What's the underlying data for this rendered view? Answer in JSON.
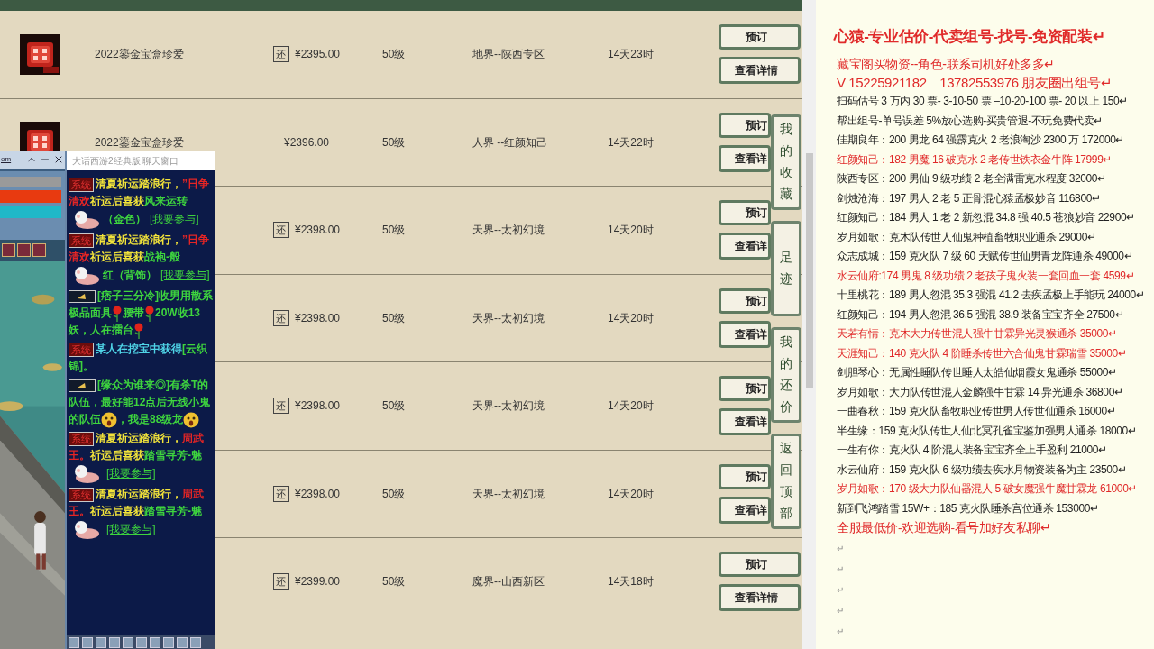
{
  "listing": {
    "rows": [
      {
        "item_icon": true,
        "name": "2022鎏金宝盒珍爱",
        "tag": "还",
        "price": "¥2395.00",
        "level": "50级",
        "server": "地界--陕西专区",
        "time": "14天23时",
        "reserve": "预订",
        "detail": "查看详情"
      },
      {
        "item_icon": true,
        "name": "2022鎏金宝盒珍爱",
        "price": "¥2396.00",
        "level": "50级",
        "server": "人界 --红颜知己",
        "time": "14天22时",
        "reserve": "预订",
        "detail": "查看详"
      },
      {
        "item_icon": false,
        "tag": "还",
        "price": "¥2398.00",
        "level": "50级",
        "server": "天界--太初幻境",
        "time": "14天20时",
        "reserve": "预订",
        "detail": "查看详"
      },
      {
        "item_icon": false,
        "tag": "还",
        "price": "¥2398.00",
        "level": "50级",
        "server": "天界--太初幻境",
        "time": "14天20时",
        "reserve": "预订",
        "detail": "查看详"
      },
      {
        "item_icon": false,
        "tag": "还",
        "price": "¥2398.00",
        "level": "50级",
        "server": "天界--太初幻境",
        "time": "14天20时",
        "reserve": "预订",
        "detail": "查看详"
      },
      {
        "item_icon": false,
        "tag": "还",
        "price": "¥2398.00",
        "level": "50级",
        "server": "天界--太初幻境",
        "time": "14天20时",
        "reserve": "预订",
        "detail": "查看详"
      },
      {
        "item_icon": false,
        "tag": "还",
        "price": "¥2399.00",
        "level": "50级",
        "server": "魔界--山西新区",
        "time": "14天18时",
        "reserve": "预订",
        "detail": "查看详情"
      }
    ]
  },
  "side_nav": [
    "我的收藏",
    "足迹",
    "我的还价",
    "返回顶部"
  ],
  "game_window": {
    "title_fragment": "om"
  },
  "chat_window": {
    "title": "大话西游2经典版 聊天窗口",
    "messages": [
      {
        "kind": "system",
        "badge": "系统",
        "segments": [
          {
            "kind": "text",
            "text": "清夏祈运踏浪行，",
            "color": "#f2e33a"
          },
          {
            "kind": "text",
            "text": "”日争清欢",
            "color": "#e42525"
          },
          {
            "kind": "text",
            "text": "祈运后喜获",
            "color": "#f2e33a"
          },
          {
            "kind": "text",
            "text": "风来运转",
            "color": "#3ed43e"
          },
          {
            "kind": "pig"
          },
          {
            "kind": "text",
            "text": "（金色）",
            "color": "#3ed43e"
          },
          {
            "kind": "link",
            "text": "[我要参与]"
          }
        ]
      },
      {
        "kind": "system",
        "badge": "系统",
        "segments": [
          {
            "kind": "text",
            "text": "清夏祈运踏浪行，",
            "color": "#f2e33a"
          },
          {
            "kind": "text",
            "text": "”日争清欢",
            "color": "#e42525"
          },
          {
            "kind": "text",
            "text": "祈运后喜获",
            "color": "#f2e33a"
          },
          {
            "kind": "text",
            "text": "战袍-般",
            "color": "#3ed43e"
          },
          {
            "kind": "pig"
          },
          {
            "kind": "text",
            "text": "红（背饰）",
            "color": "#3ed43e"
          },
          {
            "kind": "link",
            "text": "[我要参与]"
          }
        ]
      },
      {
        "kind": "player",
        "segments": [
          {
            "kind": "text",
            "text": "[痞子三分冷]收男用散系极品面具",
            "color": "#3ed43e"
          },
          {
            "kind": "flower"
          },
          {
            "kind": "text",
            "text": "腰带",
            "color": "#3ed43e"
          },
          {
            "kind": "flower"
          },
          {
            "kind": "text",
            "text": "20W收13妖，人在擂台",
            "color": "#3ed43e"
          },
          {
            "kind": "flower"
          }
        ]
      },
      {
        "kind": "system",
        "badge": "系统",
        "segments": [
          {
            "kind": "text",
            "text": "某人在挖宝中获得",
            "color": "#4fd3e6"
          },
          {
            "kind": "text",
            "text": "[云织锦]。",
            "color": "#3ed43e"
          }
        ]
      },
      {
        "kind": "player",
        "segments": [
          {
            "kind": "text",
            "text": "[缘众为谁来◎]有杀T的队伍，最好能12点后无线小鬼的队伍",
            "color": "#3ed43e"
          },
          {
            "kind": "face"
          },
          {
            "kind": "text",
            "text": "，我是88级龙",
            "color": "#3ed43e"
          },
          {
            "kind": "face"
          }
        ]
      },
      {
        "kind": "system",
        "badge": "系统",
        "segments": [
          {
            "kind": "text",
            "text": "清夏祈运踏浪行，",
            "color": "#f2e33a"
          },
          {
            "kind": "text",
            "text": "周武王。",
            "color": "#e42525"
          },
          {
            "kind": "text",
            "text": "祈运后喜获",
            "color": "#f2e33a"
          },
          {
            "kind": "text",
            "text": "踏雪寻芳-魅",
            "color": "#3ed43e"
          },
          {
            "kind": "pig"
          },
          {
            "kind": "link",
            "text": "[我要参与]"
          }
        ]
      },
      {
        "kind": "system",
        "badge": "系统",
        "segments": [
          {
            "kind": "text",
            "text": "清夏祈运踏浪行，",
            "color": "#f2e33a"
          },
          {
            "kind": "text",
            "text": "周武王。",
            "color": "#e42525"
          },
          {
            "kind": "text",
            "text": "祈运后喜获",
            "color": "#f2e33a"
          },
          {
            "kind": "text",
            "text": "踏雪寻芳-魅",
            "color": "#3ed43e"
          },
          {
            "kind": "pig"
          },
          {
            "kind": "link",
            "text": "[我要参与]"
          }
        ]
      }
    ]
  },
  "document": {
    "lines": [
      {
        "kind": "title",
        "text": "心猿-专业估价-代卖组号-找号-免资配装↵",
        "color": "#e02a2a"
      },
      {
        "kind": "subtitle",
        "text": "藏宝阁买物资--角色-联系司机好处多多↵",
        "color": "#e02a2a"
      },
      {
        "kind": "phone",
        "text": "V 15225921182　13782553976 朋友圈出组号↵",
        "color": "#e02a2a"
      },
      {
        "kind": "body",
        "text": "扫码估号 3 万内 30 票- 3-10-50 票 –10-20-100 票- 20 以上 150↵",
        "color": "#222222"
      },
      {
        "kind": "body",
        "text": "帮出组号-单号误差 5%放心选购-买贵管退-不玩免费代卖↵",
        "color": "#222222"
      },
      {
        "kind": "body",
        "text": "佳期良年：200 男龙 64 强霹克火 2 老浪淘沙 2300 万 172000↵",
        "color": "#222222"
      },
      {
        "kind": "body",
        "text": "红颜知己：182 男魔 16 破克水 2 老传世铁衣金牛阵 17999↵",
        "color": "#e02a2a"
      },
      {
        "kind": "body",
        "text": "陕西专区：200 男仙 9 级功绩 2 老全满雷克水程度 32000↵",
        "color": "#222222"
      },
      {
        "kind": "body",
        "text": "剑烛沧海：197 男人 2 老 5 正骨混心猿孟极妙音 116800↵",
        "color": "#222222"
      },
      {
        "kind": "body",
        "text": "红颜知己：184 男人 1 老 2 新忽混 34.8 强 40.5 苍狼妙音 22900↵",
        "color": "#222222"
      },
      {
        "kind": "body",
        "text": "岁月如歌：克木队传世人仙鬼种植畜牧职业通杀 29000↵",
        "color": "#222222"
      },
      {
        "kind": "body",
        "text": "众志成城：159 克火队 7 级 60 天赋传世仙男青龙阵通杀 49000↵",
        "color": "#222222"
      },
      {
        "kind": "body",
        "text": "水云仙府:174 男鬼 8 级功绩 2 老孩子鬼火装一套回血一套 4599↵",
        "color": "#e02a2a"
      },
      {
        "kind": "body",
        "text": "十里桃花：189 男人忽混 35.3 强混 41.2 去疾孟极上手能玩 24000↵",
        "color": "#222222"
      },
      {
        "kind": "body",
        "text": "红颜知己：194 男人忽混 36.5 强混 38.9 装备宝宝齐全 27500↵",
        "color": "#222222"
      },
      {
        "kind": "body",
        "text": "天若有情：克木大力传世混人强牛甘霖异光灵猴通杀 35000↵",
        "color": "#e02a2a"
      },
      {
        "kind": "body",
        "text": "天涯知己：140 克火队 4 阶睡杀传世六合仙鬼甘霖瑞雪 35000↵",
        "color": "#e02a2a"
      },
      {
        "kind": "body",
        "text": "剑胆琴心：无属性睡队传世睡人太皓仙烟霞女鬼通杀 55000↵",
        "color": "#222222"
      },
      {
        "kind": "body",
        "text": "岁月如歌：大力队传世混人金麟强牛甘霖 14 异光通杀 36800↵",
        "color": "#222222"
      },
      {
        "kind": "body",
        "text": "一曲春秋：159 克火队畜牧职业传世男人传世仙通杀 16000↵",
        "color": "#222222"
      },
      {
        "kind": "body",
        "text": "半生缘：159 克火队传世人仙北冥孔雀宝鉴加强男人通杀 18000↵",
        "color": "#222222"
      },
      {
        "kind": "body",
        "text": "一生有你：克火队 4 阶混人装备宝宝齐全上手盈利 21000↵",
        "color": "#222222"
      },
      {
        "kind": "body",
        "text": "水云仙府：159 克火队 6 级功绩去疾水月物资装备为主 23500↵",
        "color": "#222222"
      },
      {
        "kind": "body",
        "text": "岁月如歌：170 级大力队仙器混人 5 破女魔强牛魔甘霖龙 61000↵",
        "color": "#e02a2a"
      },
      {
        "kind": "body",
        "text": "新到飞鸿踏雪 15W+：185 克火队睡杀宫位通杀 153000↵",
        "color": "#222222"
      },
      {
        "kind": "closing",
        "text": "全服最低价-欢迎选购-看号加好友私聊↵",
        "color": "#e02a2a"
      },
      {
        "kind": "blank",
        "text": "↵"
      },
      {
        "kind": "blank",
        "text": "↵"
      },
      {
        "kind": "blank",
        "text": "↵"
      },
      {
        "kind": "blank",
        "text": "↵"
      },
      {
        "kind": "blank",
        "text": "↵"
      }
    ]
  }
}
